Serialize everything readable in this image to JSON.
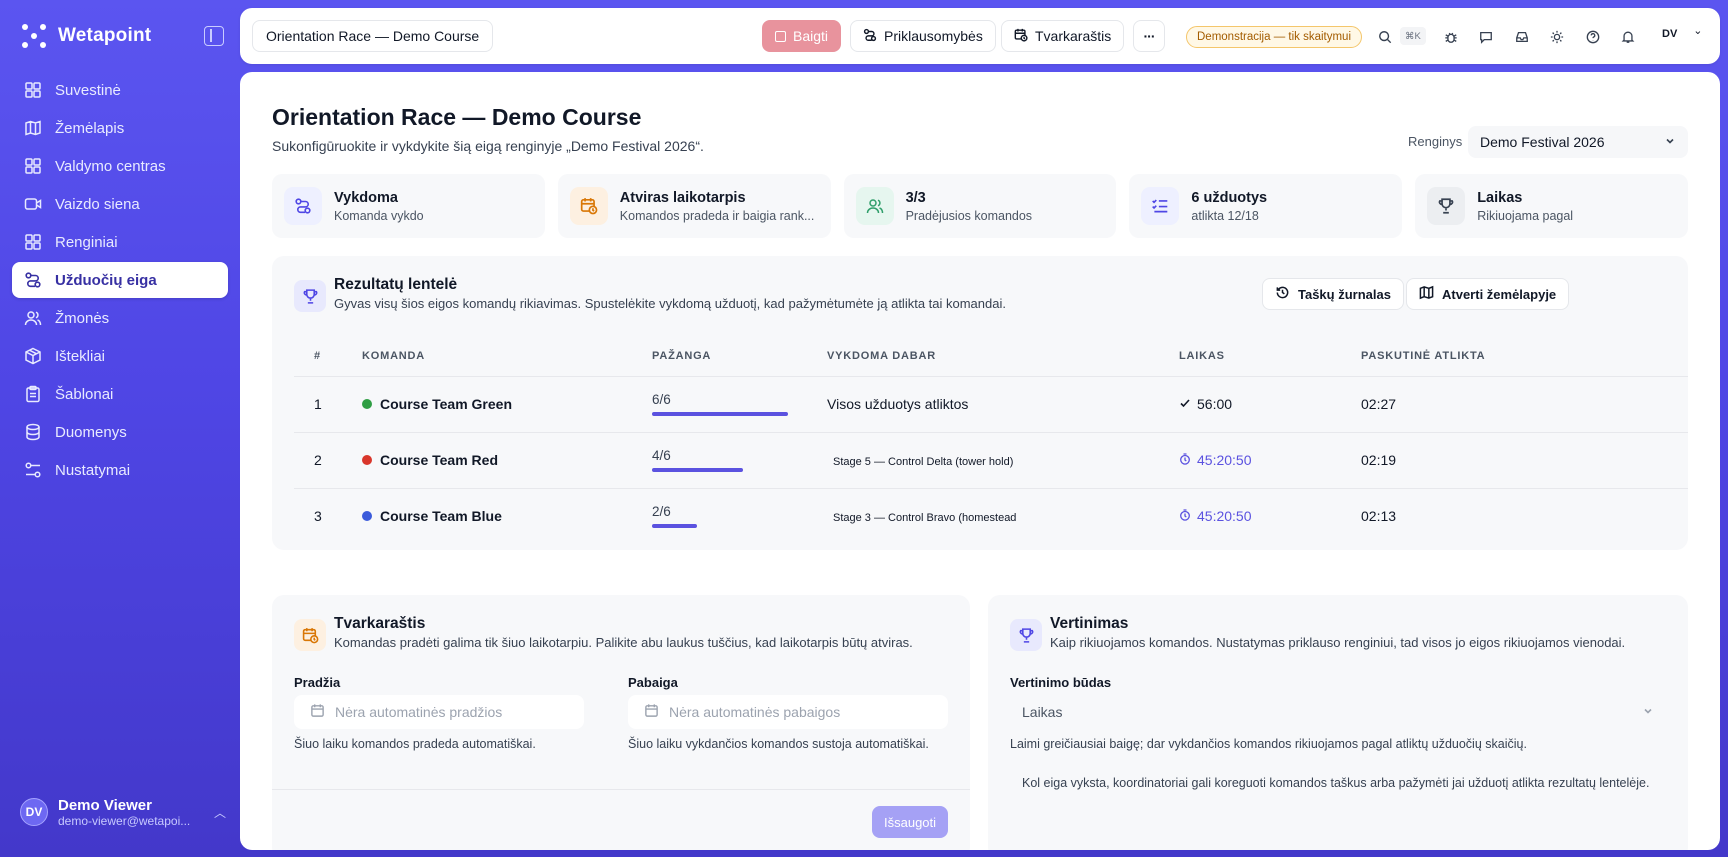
{
  "brand": {
    "name": "Wetapoint"
  },
  "sidebar": {
    "items": [
      {
        "label": "Suvestinė",
        "icon": "dashboard-icon"
      },
      {
        "label": "Žemėlapis",
        "icon": "map-icon"
      },
      {
        "label": "Valdymo centras",
        "icon": "grid-icon"
      },
      {
        "label": "Vaizdo siena",
        "icon": "video-icon"
      },
      {
        "label": "Renginiai",
        "icon": "events-icon"
      },
      {
        "label": "Užduočių eiga",
        "icon": "route-icon"
      },
      {
        "label": "Žmonės",
        "icon": "people-icon"
      },
      {
        "label": "Ištekliai",
        "icon": "box-icon"
      },
      {
        "label": "Šablonai",
        "icon": "clipboard-icon"
      },
      {
        "label": "Duomenys",
        "icon": "database-icon"
      },
      {
        "label": "Nustatymai",
        "icon": "settings-icon"
      }
    ],
    "active_index": 5
  },
  "user": {
    "initials": "DV",
    "name": "Demo Viewer",
    "email": "demo-viewer@wetapoi..."
  },
  "topbar": {
    "breadcrumb": "Orientation Race — Demo Course",
    "finish_label": "Baigti",
    "dependencies_label": "Priklausomybės",
    "schedule_label": "Tvarkaraštis",
    "more_label": "···",
    "demo_badge": "Demonstracija — tik skaitymui",
    "shortcut": "⌘K",
    "user_initials": "DV",
    "user_chevron": "⌄"
  },
  "page": {
    "title": "Orientation Race — Demo Course",
    "subtitle": "Sukonfigūruokite ir vykdykite šią eigą renginyje „Demo Festival 2026“.",
    "event_label": "Renginys",
    "event_value": "Demo Festival 2026"
  },
  "stats": [
    {
      "title": "Vykdoma",
      "sub": "Komanda vykdo",
      "icon": "route-icon",
      "color": "#eef0ff"
    },
    {
      "title": "Atviras laikotarpis",
      "sub": "Komandos pradeda ir baigia rank...",
      "icon": "calendar-clock-icon",
      "color": "#fdf0e1"
    },
    {
      "title": "3/3",
      "sub": "Pradėjusios komandos",
      "icon": "people-icon",
      "color": "#e6f6ef"
    },
    {
      "title": "6 užduotys",
      "sub": "atlikta 12/18",
      "icon": "list-check-icon",
      "color": "#eef0ff"
    },
    {
      "title": "Laikas",
      "sub": "Rikiuojama pagal",
      "icon": "trophy-icon",
      "color": "#eceef1"
    }
  ],
  "leaderboard": {
    "title": "Rezultatų lentelė",
    "subtitle": "Gyvas visų šios eigos komandų rikiavimas. Spustelėkite vykdomą užduotį, kad pažymėtumėte ją atlikta tai komandai.",
    "log_button": "Taškų žurnalas",
    "map_button": "Atverti žemėlapyje",
    "columns": [
      "#",
      "KOMANDA",
      "PAŽANGA",
      "VYKDOMA DABAR",
      "LAIKAS",
      "PASKUTINĖ ATLIKTA"
    ],
    "rows": [
      {
        "rank": "1",
        "team": "Course Team Green",
        "color": "#2f9e44",
        "progress_label": "6/6",
        "progress": 1.0,
        "current": "Visos užduotys atliktos",
        "current_small": false,
        "time": "56:00",
        "running": false,
        "last": "02:27"
      },
      {
        "rank": "2",
        "team": "Course Team Red",
        "color": "#d9362b",
        "progress_label": "4/6",
        "progress": 0.667,
        "current": "Stage 5 — Control Delta (tower hold)",
        "current_small": true,
        "time": "45:20:50",
        "running": true,
        "last": "02:19"
      },
      {
        "rank": "3",
        "team": "Course Team Blue",
        "color": "#3b5bdb",
        "progress_label": "2/6",
        "progress": 0.333,
        "current": "Stage 3 — Control Bravo (homestead",
        "current_small": true,
        "time": "45:20:50",
        "running": true,
        "last": "02:13"
      }
    ]
  },
  "schedule": {
    "title": "Tvarkaraštis",
    "subtitle": "Komandas pradėti galima tik šiuo laikotarpiu. Palikite abu laukus tuščius, kad laikotarpis būtų atviras.",
    "start_label": "Pradžia",
    "start_placeholder": "Nėra automatinės pradžios",
    "start_hint": "Šiuo laiku komandos pradeda automatiškai.",
    "end_label": "Pabaiga",
    "end_placeholder": "Nėra automatinės pabaigos",
    "end_hint": "Šiuo laiku vykdančios komandos sustoja automatiškai.",
    "save_label": "Išsaugoti"
  },
  "scoring": {
    "title": "Vertinimas",
    "subtitle": "Kaip rikiuojamos komandos. Nustatymas priklauso renginiui, tad visos jo eigos rikiuojamos vienodai.",
    "method_label": "Vertinimo būdas",
    "method_value": "Laikas",
    "method_hint": "Laimi greičiausiai baigę; dar vykdančios komandos rikiuojamos pagal atliktų užduočių skaičių.",
    "note": "Kol eiga vyksta, koordinatoriai gali koreguoti komandos taškus arba pažymėti jai užduotį atlikta rezultatų lentelėje."
  },
  "colors": {
    "accent": "#5b52e0",
    "finish": "#e8939d",
    "sidebar": "#4f46e5"
  }
}
